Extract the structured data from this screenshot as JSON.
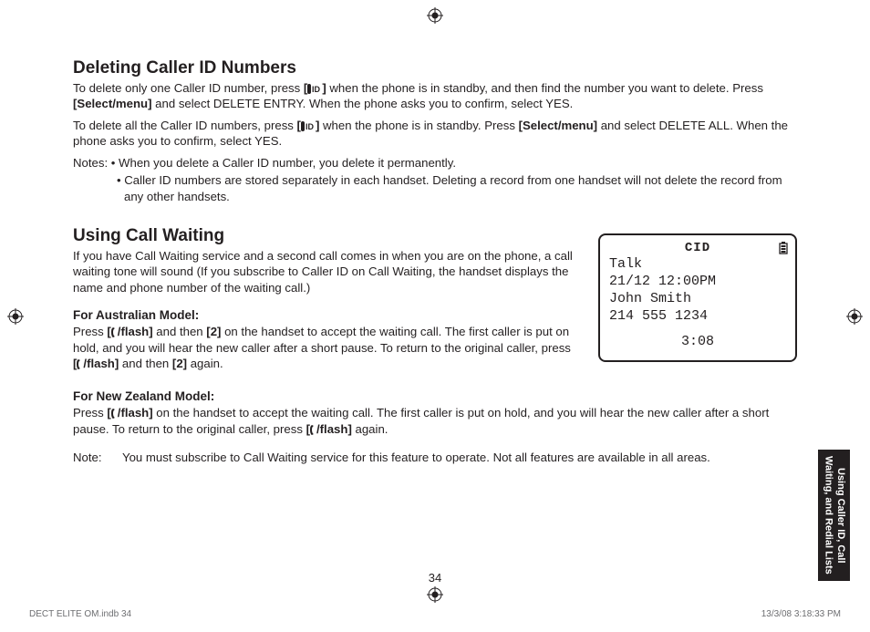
{
  "page": {
    "h1": "Deleting Caller ID Numbers",
    "p1a": "To delete only one Caller ID number, press ",
    "p1b": " when the phone is in standby, and then find the number you want to delete. Press ",
    "p1c": "[Select/menu]",
    "p1d": " and select DELETE ENTRY. When the phone asks you to confirm, select YES.",
    "p2a": "To delete all the Caller ID numbers, press ",
    "p2b": " when the phone is in standby. Press ",
    "p2c": "[Select/menu]",
    "p2d": " and select DELETE ALL. When the phone asks you to confirm, select YES.",
    "notesLabel": "Notes: ",
    "note1": "• When you delete a Caller ID number, you delete it permanently.",
    "note2": "• Caller ID numbers are stored separately in each handset. Deleting a record from one handset will not delete the record from any other handsets.",
    "h2": "Using Call Waiting",
    "cwIntro": "If you have Call Waiting service and a second call comes in when you are on the phone, a call waiting tone will sound (If you subscribe to Caller ID on Call Waiting, the handset displays the name and phone number of the waiting call.)",
    "ausHead": "For Australian Model:",
    "ausA": "Press ",
    "flash": "[ /flash]",
    "ausB": " and then ",
    "two": "[2]",
    "ausC": " on the handset to accept the waiting call. The first caller is put on hold, and you will hear the new caller after a short pause. To return to the original caller, press ",
    "ausD": " and then ",
    "ausE": " again.",
    "nzHead": "For New Zealand Model:",
    "nzA": "Press ",
    "nzB": " on the handset to accept the waiting call. The first caller is put on hold, and you will hear the new caller after a short pause. To return to the original caller, press ",
    "nzC": " again.",
    "noteLabel": "Note:",
    "noteFinal": "You must subscribe to Call Waiting service for this feature to operate. Not all features are available in all areas.",
    "pageNum": "34",
    "sideTab": "Using Caller ID, Call Waiting, and Redial Lists",
    "cidBracketL": "[",
    "cidBracketR": "]",
    "flashOpen": "[",
    "flashText": "/flash]"
  },
  "lcd": {
    "cid": "CID",
    "l1": "Talk",
    "l2": "21/12 12:00PM",
    "l3": "John Smith",
    "l4": "214 555 1234",
    "timer": "3:08"
  },
  "footer": {
    "left": "DECT ELITE OM.indb   34",
    "right": "13/3/08   3:18:33 PM"
  }
}
